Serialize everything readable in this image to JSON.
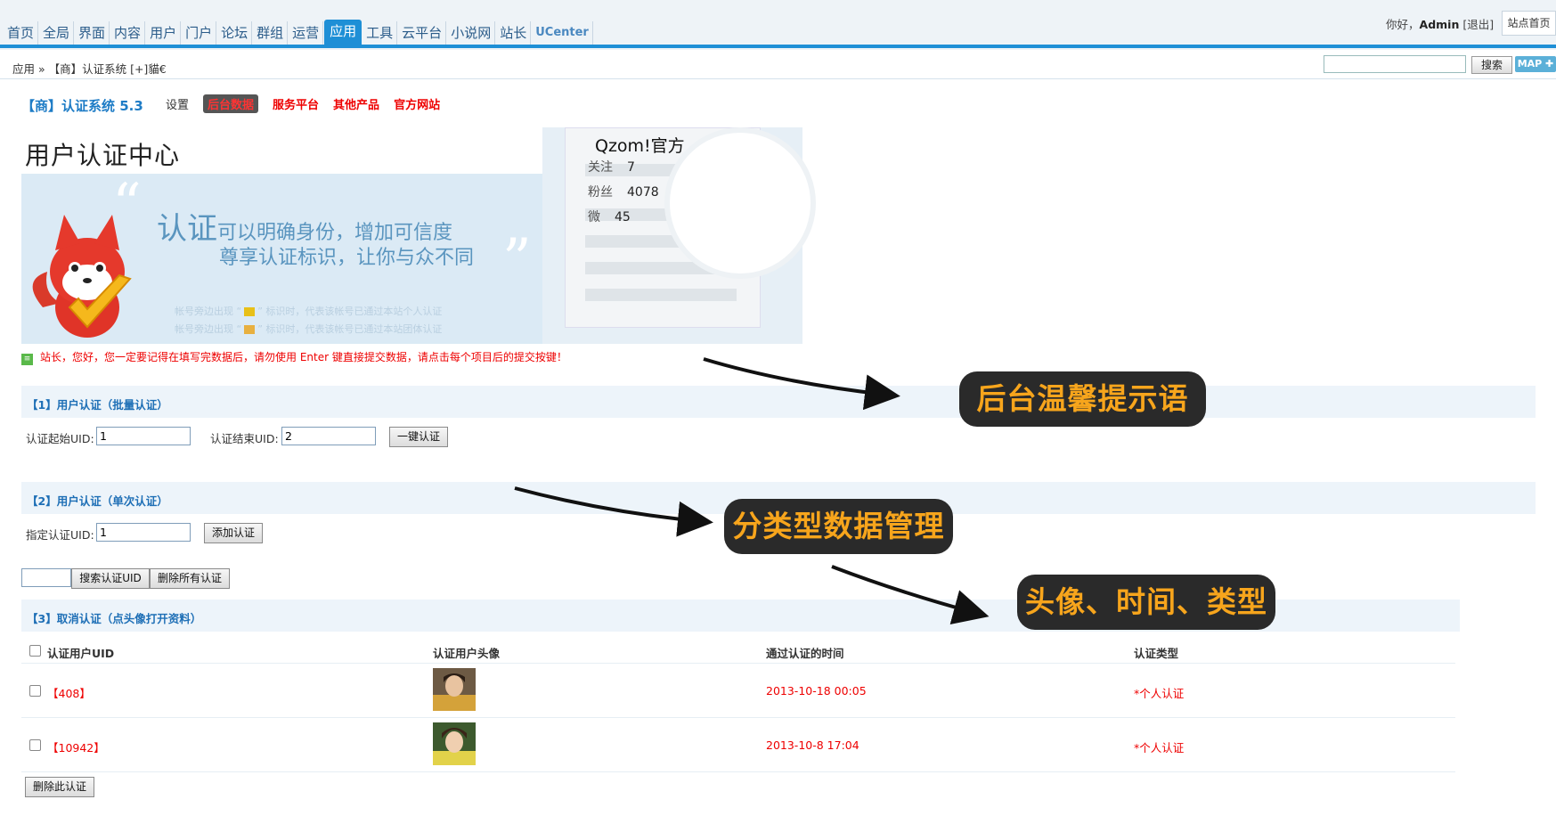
{
  "nav": {
    "items": [
      "首页",
      "全局",
      "界面",
      "内容",
      "用户",
      "门户",
      "论坛",
      "群组",
      "运营",
      "应用",
      "工具",
      "云平台",
      "小说网",
      "站长",
      "UCenter"
    ],
    "active": "应用",
    "greeting_prefix": "你好，",
    "user": "Admin",
    "logout": "[退出]",
    "site_home": "站点首页"
  },
  "breadcrumb": "应用 » 【商】认证系统 [+]貓€",
  "search": {
    "button": "搜索",
    "map": "MAP ✚"
  },
  "plugin": {
    "title": "【商】认证系统 5.3",
    "links": [
      "设置",
      "后台数据",
      "服务平台",
      "其他产品",
      "官方网站"
    ]
  },
  "banner": {
    "heading": "用户认证中心",
    "slogan_big": "认证",
    "slogan_line1": "可以明确身份，增加可信度",
    "slogan_line2": "尊享认证标识，让你与众不同",
    "note1_pre": "帐号旁边出现 “",
    "note1_post": "” 标识时，代表该帐号已通过本站个人认证",
    "note2_pre": "帐号旁边出现 “",
    "note2_post": "” 标识时，代表该帐号已通过本站团体认证",
    "profile_name": "Qzom!官方",
    "stats": [
      {
        "label": "关注",
        "value": "7"
      },
      {
        "label": "粉丝",
        "value": "4078"
      },
      {
        "label": "微",
        "value": "45"
      }
    ]
  },
  "tip": "站长，您好，您一定要记得在填写完数据后，请勿使用 Enter 键直接提交数据，请点击每个项目后的提交按键！",
  "section1": {
    "title": "【1】用户认证（批量认证）",
    "start_label": "认证起始UID:",
    "start_value": "1",
    "end_label": "认证结束UID:",
    "end_value": "2",
    "button": "一键认证"
  },
  "section2": {
    "title": "【2】用户认证（单次认证）",
    "uid_label": "指定认证UID:",
    "uid_value": "1",
    "button": "添加认证"
  },
  "tools": {
    "search_button": "搜索认证UID",
    "delete_all_button": "删除所有认证"
  },
  "section3": {
    "title": "【3】取消认证（点头像打开资料）",
    "columns": [
      "认证用户UID",
      "认证用户头像",
      "通过认证的时间",
      "认证类型"
    ],
    "rows": [
      {
        "uid": "【408】",
        "time": "2013-10-18 00:05",
        "type": "*个人认证"
      },
      {
        "uid": "【10942】",
        "time": "2013-10-8 17:04",
        "type": "*个人认证"
      }
    ],
    "delete_button": "删除此认证"
  },
  "callouts": [
    "后台温馨提示语",
    "分类型数据管理",
    "头像、时间、类型"
  ],
  "colors": {
    "accent": "#1e8fd6",
    "alert_red": "#ee0000",
    "callout_bg": "#2a2a2a",
    "callout_text": "#f7a51c"
  }
}
